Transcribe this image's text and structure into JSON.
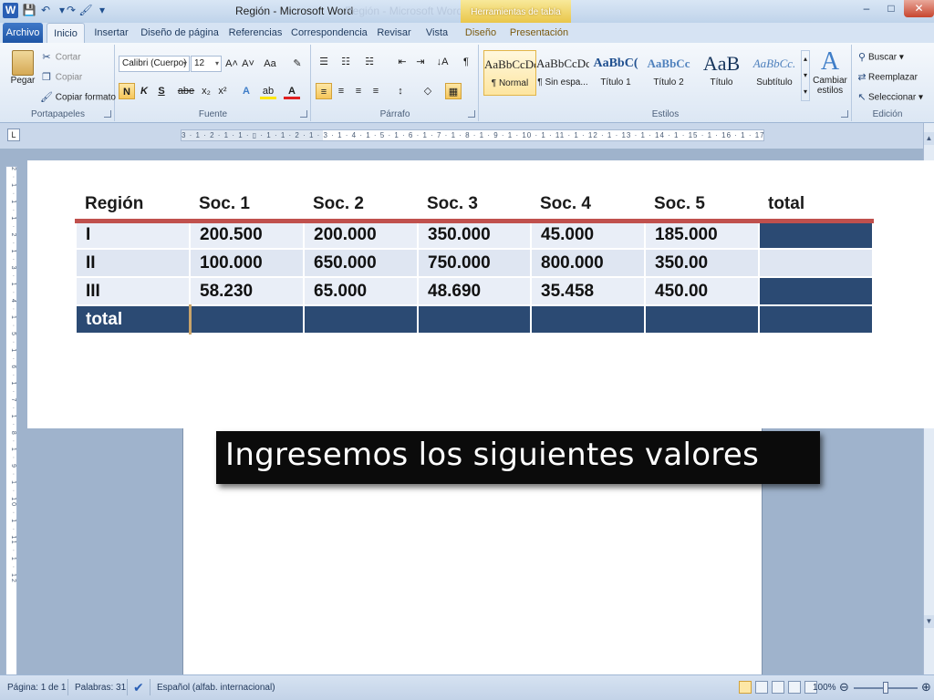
{
  "titlebar": {
    "app_letter": "W",
    "title": "Región - Microsoft Word",
    "ghost_title": "Región - Microsoft Word",
    "contextual_tab": "Herramientas de tabla",
    "min_glyph": "–",
    "max_glyph": "□",
    "close_glyph": "✕",
    "qat_save": "💾",
    "qat_undo": "↶",
    "qat_redo": "↷",
    "qat_paint": "🖌",
    "qat_more": "▾"
  },
  "tabs": [
    {
      "label": "Archivo"
    },
    {
      "label": "Inicio"
    },
    {
      "label": "Insertar"
    },
    {
      "label": "Diseño de página"
    },
    {
      "label": "Referencias"
    },
    {
      "label": "Correspondencia"
    },
    {
      "label": "Revisar"
    },
    {
      "label": "Vista"
    },
    {
      "label": "Diseño"
    },
    {
      "label": "Presentación"
    }
  ],
  "ribbon": {
    "clipboard": {
      "group_label": "Portapapeles",
      "paste": "Pegar",
      "cut": "Cortar",
      "copy": "Copiar",
      "format_painter": "Copiar formato"
    },
    "font": {
      "group_label": "Fuente",
      "font_name": "Calibri (Cuerpo)",
      "font_size": "12",
      "bold": "N",
      "italic": "K",
      "underline": "S",
      "strike": "abe",
      "subscript": "x₂",
      "superscript": "x²",
      "grow": "A˄",
      "shrink": "A˅",
      "case": "Aa",
      "clear": "✎",
      "effects": "A",
      "highlight": "ab",
      "color": "A"
    },
    "paragraph": {
      "group_label": "Párrafo",
      "bullets": "☰",
      "numbering": "☷",
      "multilevel": "☵",
      "decrease_indent": "⇤",
      "increase_indent": "⇥",
      "sort": "↓A",
      "pilcrow": "¶",
      "align_left": "≡",
      "align_center": "≡",
      "align_right": "≡",
      "justify": "≡",
      "line_spacing": "↕",
      "shading": "◇",
      "borders": "▦"
    },
    "styles": {
      "group_label": "Estilos",
      "change_styles": "Cambiar estilos",
      "change_styles_icon": "A",
      "items": [
        {
          "sample": "AaBbCcDc",
          "name": "¶ Normal"
        },
        {
          "sample": "AaBbCcDc",
          "name": "¶ Sin espa..."
        },
        {
          "sample": "AaBbC(",
          "name": "Título 1"
        },
        {
          "sample": "AaBbCc",
          "name": "Título 2"
        },
        {
          "sample": "AaB",
          "name": "Título"
        },
        {
          "sample": "AaBbCc.",
          "name": "Subtítulo"
        }
      ]
    },
    "editing": {
      "group_label": "Edición",
      "find": "Buscar",
      "replace": "Reemplazar",
      "select": "Seleccionar"
    }
  },
  "ruler": {
    "corner": "L",
    "ticks": "3 · 1 · 2 · 1 · 1 · ▯ · 1 · 1 · 2 · 1 · 3 · 1 · 4 · 1 · 5 · 1 · 6 · 1 · 7 · 1 · 8 · 1 · 9 · 1 · 10 · 1 · 11 · 1 · 12 · 1 · 13 · 1 · 14 · 1 · 15 · 1 · 16 · 1 · 17 · 1 · 18",
    "vticks": "2 · 1 · 1 · 1 · 2 · 1 · 3 · 1 · 4 · 1 · 5 · 1 · 6 · 1 · 7 · 1 · 8 · 1 · 9 · 1 · 10 · 1 · 11 · 1 · 12"
  },
  "scroll": {
    "up": "▲",
    "down": "▼"
  },
  "table": {
    "headers": [
      "Región",
      "Soc. 1",
      "Soc. 2",
      "Soc. 3",
      "Soc. 4",
      "Soc. 5",
      "total"
    ],
    "rows": [
      [
        "I",
        "200.500",
        "200.000",
        "350.000",
        "45.000",
        "185.000",
        ""
      ],
      [
        "II",
        "100.000",
        "650.000",
        "750.000",
        "800.000",
        "350.00",
        ""
      ],
      [
        "III",
        "58.230",
        "65.000",
        "48.690",
        "35.458",
        "450.00",
        ""
      ],
      [
        "total",
        "",
        "",
        "",
        "",
        "",
        ""
      ]
    ]
  },
  "caption": "Ingresemos los siguientes valores",
  "statusbar": {
    "page": "Página: 1 de 1",
    "words": "Palabras: 31",
    "spell_icon": "✔",
    "language": "Español (alfab. internacional)",
    "zoom": "100%",
    "zoom_out": "⊖",
    "zoom_in": "⊕"
  },
  "colors": {
    "header_border": "#c0504d",
    "navy": "#2b4a73",
    "cell_light": "#e9eef7",
    "ribbon_tab_file": "#2a5fb5"
  }
}
